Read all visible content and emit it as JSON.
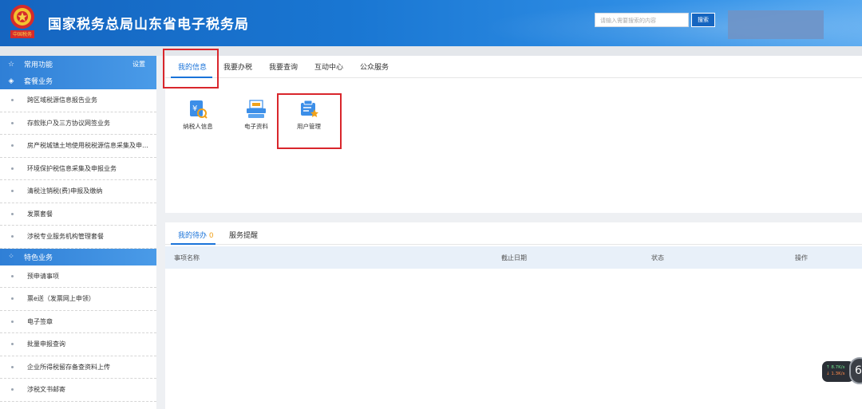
{
  "header": {
    "emblem_caption": "中国税务",
    "title": "国家税务总局山东省电子税务局",
    "search_placeholder": "请输入需要搜索的内容",
    "search_button": "搜索"
  },
  "sidebar": {
    "common": {
      "label": "常用功能",
      "settings": "设置"
    },
    "package": {
      "label": "套餐业务",
      "items": [
        "跨区域税源信息报告业务",
        "存款账户及三方协议网签业务",
        "房产税城镇土地使用税税源信息采集及申…",
        "环境保护税信息采集及申报业务",
        "清税注销税(费)申报及缴纳",
        "发票套餐",
        "涉税专业服务机构管理套餐"
      ]
    },
    "special": {
      "label": "特色业务",
      "items": [
        "预申请事项",
        "票e送（发票网上申领）",
        "电子签章",
        "批量申报查询",
        "企业所得税留存备查资料上传",
        "涉税文书邮寄"
      ]
    }
  },
  "main_tabs": [
    "我的信息",
    "我要办税",
    "我要查询",
    "互动中心",
    "公众服务"
  ],
  "tiles": [
    {
      "label": "纳税人信息",
      "icon": "taxpayer-info-icon"
    },
    {
      "label": "电子资料",
      "icon": "electronic-data-icon"
    },
    {
      "label": "用户管理",
      "icon": "user-management-icon"
    }
  ],
  "bottom": {
    "todo_label": "我的待办",
    "todo_count": "0",
    "reminder_label": "服务提醒",
    "columns": [
      "事项名称",
      "截止日期",
      "状态",
      "操作"
    ]
  },
  "speed_widget": {
    "up": "↑ 8.7K/s",
    "down": "↓ 1.3K/s",
    "badge": "6"
  },
  "colors": {
    "header_blue": "#1976d2",
    "accent": "#1a73d9",
    "highlight_red": "#d9262c"
  }
}
